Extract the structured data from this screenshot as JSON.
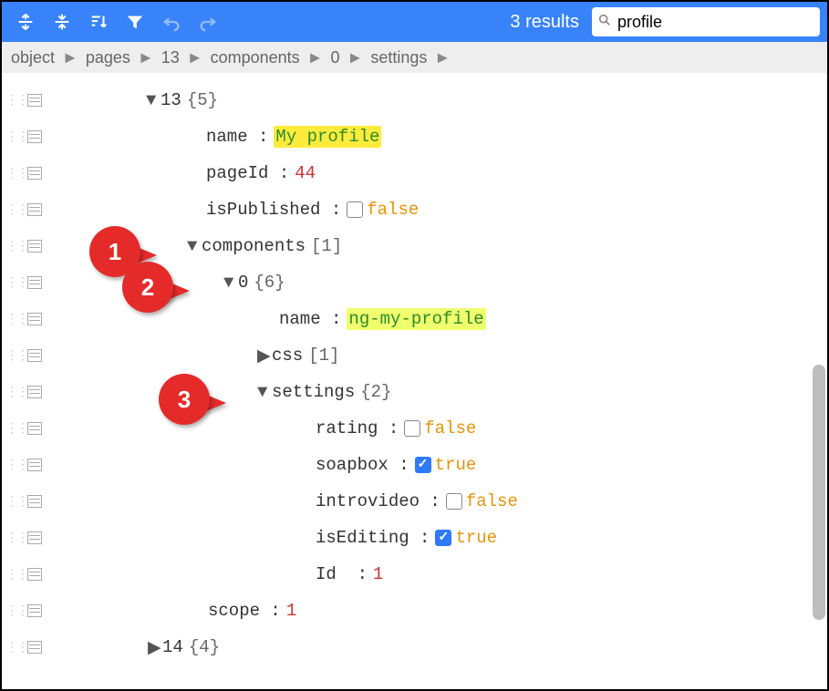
{
  "toolbar": {
    "results_text": "3 results",
    "search_value": "profile"
  },
  "breadcrumb": {
    "parts": [
      "object",
      "pages",
      "13",
      "components",
      "0",
      "settings"
    ]
  },
  "tree": {
    "r0": {
      "key": "13",
      "count": "{5}"
    },
    "r1": {
      "key": "name",
      "value": "My profile"
    },
    "r2": {
      "key": "pageId",
      "value": "44"
    },
    "r3": {
      "key": "isPublished",
      "value": "false",
      "checked": false
    },
    "r4": {
      "key": "components",
      "count": "[1]"
    },
    "r5": {
      "key": "0",
      "count": "{6}"
    },
    "r6": {
      "key": "name",
      "value": "ng-my-profile"
    },
    "r7": {
      "key": "css",
      "count": "[1]"
    },
    "r8": {
      "key": "settings",
      "count": "{2}"
    },
    "r9": {
      "key": "rating",
      "value": "false",
      "checked": false
    },
    "r10": {
      "key": "soapbox",
      "value": "true",
      "checked": true
    },
    "r11": {
      "key": "introvideo",
      "value": "false",
      "checked": false
    },
    "r12": {
      "key": "isEditing",
      "value": "true",
      "checked": true
    },
    "r13": {
      "key": "Id",
      "value": "1"
    },
    "r14": {
      "key": "scope",
      "value": "1"
    },
    "r15": {
      "key": "14",
      "count": "{4}"
    }
  },
  "callouts": {
    "c1": "1",
    "c2": "2",
    "c3": "3"
  }
}
